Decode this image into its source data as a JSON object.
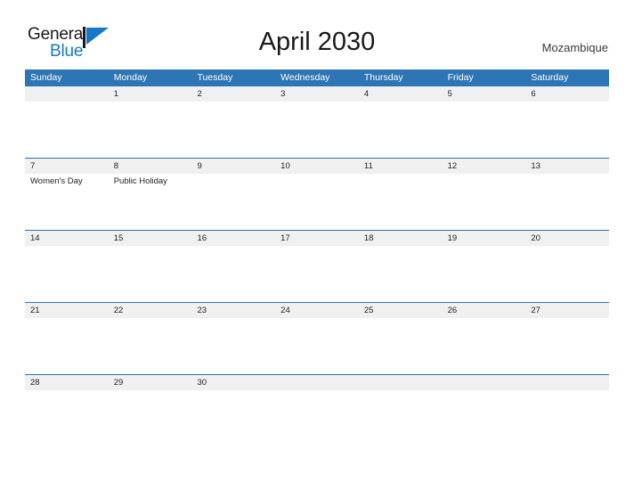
{
  "brand": {
    "name_part1": "General",
    "name_part2": "Blue",
    "flag_color": "#1878c8",
    "text_color": "#1a1a1a"
  },
  "header": {
    "title": "April 2030",
    "country": "Mozambique"
  },
  "theme": {
    "header_blue": "#2e75b6",
    "date_band": "#f0f0f0",
    "rule_blue": "#2e75b6",
    "text": "#222222"
  },
  "calendar": {
    "weekdays": [
      "Sunday",
      "Monday",
      "Tuesday",
      "Wednesday",
      "Thursday",
      "Friday",
      "Saturday"
    ],
    "weeks": [
      {
        "days": [
          {
            "num": "",
            "events": []
          },
          {
            "num": "1",
            "events": []
          },
          {
            "num": "2",
            "events": []
          },
          {
            "num": "3",
            "events": []
          },
          {
            "num": "4",
            "events": []
          },
          {
            "num": "5",
            "events": []
          },
          {
            "num": "6",
            "events": []
          }
        ]
      },
      {
        "days": [
          {
            "num": "7",
            "events": [
              {
                "label": "Women's Day"
              }
            ]
          },
          {
            "num": "8",
            "events": [
              {
                "label": "Public Holiday"
              }
            ]
          },
          {
            "num": "9",
            "events": []
          },
          {
            "num": "10",
            "events": []
          },
          {
            "num": "11",
            "events": []
          },
          {
            "num": "12",
            "events": []
          },
          {
            "num": "13",
            "events": []
          }
        ]
      },
      {
        "days": [
          {
            "num": "14",
            "events": []
          },
          {
            "num": "15",
            "events": []
          },
          {
            "num": "16",
            "events": []
          },
          {
            "num": "17",
            "events": []
          },
          {
            "num": "18",
            "events": []
          },
          {
            "num": "19",
            "events": []
          },
          {
            "num": "20",
            "events": []
          }
        ]
      },
      {
        "days": [
          {
            "num": "21",
            "events": []
          },
          {
            "num": "22",
            "events": []
          },
          {
            "num": "23",
            "events": []
          },
          {
            "num": "24",
            "events": []
          },
          {
            "num": "25",
            "events": []
          },
          {
            "num": "26",
            "events": []
          },
          {
            "num": "27",
            "events": []
          }
        ]
      },
      {
        "days": [
          {
            "num": "28",
            "events": []
          },
          {
            "num": "29",
            "events": []
          },
          {
            "num": "30",
            "events": []
          },
          {
            "num": "",
            "events": []
          },
          {
            "num": "",
            "events": []
          },
          {
            "num": "",
            "events": []
          },
          {
            "num": "",
            "events": []
          }
        ]
      }
    ]
  }
}
